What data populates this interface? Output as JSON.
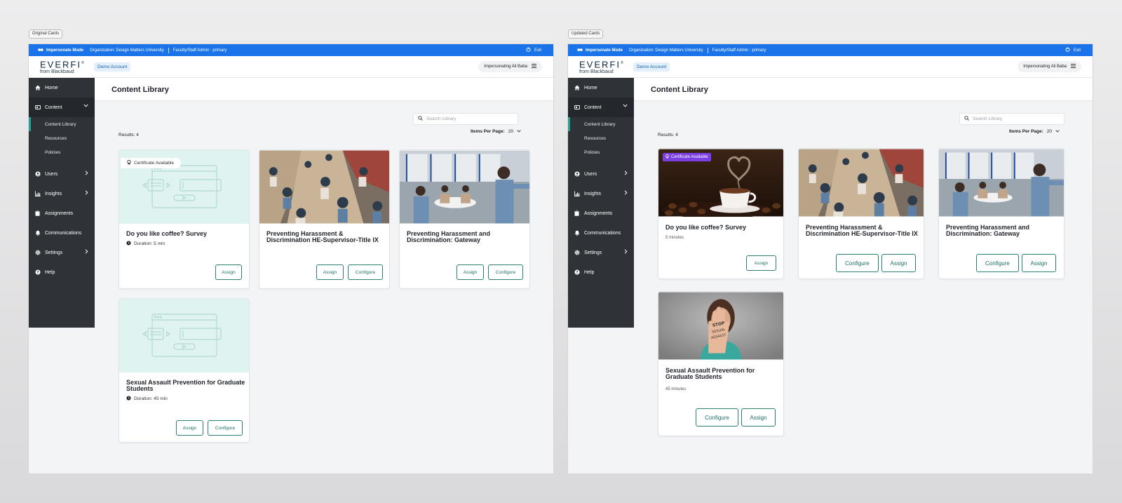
{
  "labels": {
    "left": "Original Cards",
    "right": "Updated Cards"
  },
  "topbar": {
    "mode": "Impersonate Mode",
    "organization": "Organization: Design Matters University",
    "role": "Faculty/Staff Admin : primary",
    "exit": "Exit"
  },
  "header": {
    "brand": "EVERFI",
    "brand_mark": "®",
    "from": "from Blackbaud",
    "demo_account": "Demo Account",
    "impersonating": "Impersonating Ali Baba"
  },
  "sidebar": {
    "home": "Home",
    "content": "Content",
    "content_library": "Content Library",
    "resources": "Resources",
    "policies": "Policies",
    "users": "Users",
    "insights": "Insights",
    "assignments": "Assignments",
    "communications": "Communications",
    "settings": "Settings",
    "help": "Help"
  },
  "page": {
    "title": "Content Library",
    "search_placeholder": "Search Library",
    "results": "Results: 4",
    "items_per_page_label": "Items Per Page:",
    "items_per_page_value": "20"
  },
  "original_cards": [
    {
      "title": "Do you like coffee? Survey",
      "meta": "Duration: 5 min",
      "certificate": "Certificate Available",
      "assign": "Assign"
    },
    {
      "title_line1": "Preventing Harassment &",
      "title_line2": "Discrimination HE-Supervisor-Title IX",
      "assign": "Assign",
      "configure": "Configure"
    },
    {
      "title_line1": "Preventing Harassment and",
      "title_line2": "Discrimination: Gateway",
      "assign": "Assign",
      "configure": "Configure"
    },
    {
      "title_line1": "Sexual Assault Prevention for Graduate",
      "title_line2": "Students",
      "meta": "Duration: 45 min",
      "assign": "Assign",
      "configure": "Configure"
    }
  ],
  "updated_cards": [
    {
      "title": "Do you like coffee? Survey",
      "meta": "5 minutes",
      "certificate": "Certificate Available",
      "assign": "Assign"
    },
    {
      "title_line1": "Preventing Harassment &",
      "title_line2": "Discrimination HE-Supervisor-Title IX",
      "configure": "Configure",
      "assign": "Assign"
    },
    {
      "title_line1": "Preventing Harassment and",
      "title_line2": "Discrimination: Gateway",
      "configure": "Configure",
      "assign": "Assign"
    },
    {
      "title_line1": "Sexual Assault Prevention for",
      "title_line2": "Graduate Students",
      "meta": "45 minutes",
      "configure": "Configure",
      "assign": "Assign"
    }
  ],
  "colors": {
    "topbar": "#1a73e8",
    "sidebar": "#2f3338",
    "accent": "#2a7d73",
    "badge": "#7b3fe4",
    "placeholder": "#dff4f0"
  }
}
